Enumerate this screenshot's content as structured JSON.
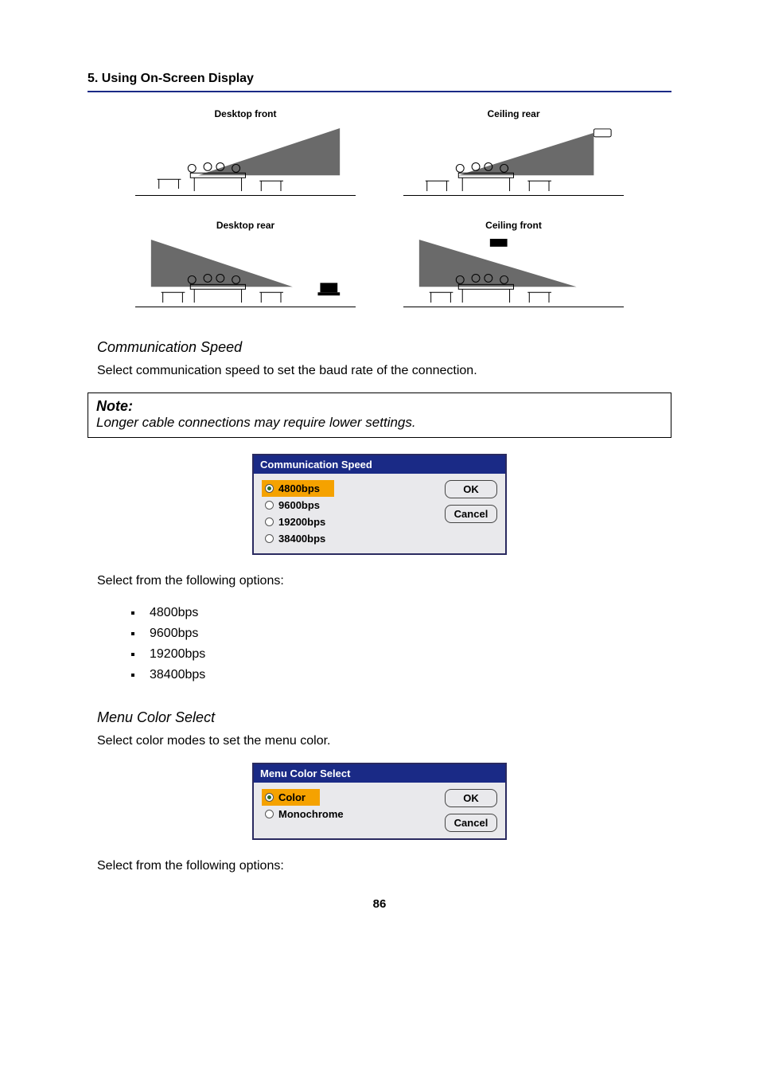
{
  "header": {
    "title": "5. Using On-Screen Display"
  },
  "layouts": {
    "tl": "Desktop front",
    "tr": "Ceiling rear",
    "bl": "Desktop rear",
    "br": "Ceiling front"
  },
  "comm": {
    "heading": "Communication Speed",
    "intro": "Select communication speed to set the baud rate of the connection.",
    "note_title": "Note:",
    "note_body": "Longer cable connections may require lower settings.",
    "dialog_title": "Communication Speed",
    "options": {
      "o1": "4800bps",
      "o2": "9600bps",
      "o3": "19200bps",
      "o4": "38400bps"
    },
    "btn_ok": "OK",
    "btn_cancel": "Cancel",
    "after": "Select from the following options:",
    "bullets": {
      "b1": "4800bps",
      "b2": "9600bps",
      "b3": "19200bps",
      "b4": "38400bps"
    }
  },
  "menucolor": {
    "heading": "Menu Color Select",
    "intro": "Select color modes to set the menu color.",
    "dialog_title": "Menu Color Select",
    "options": {
      "o1": "Color",
      "o2": "Monochrome"
    },
    "btn_ok": "OK",
    "btn_cancel": "Cancel",
    "after": "Select from the following options:"
  },
  "page": "86"
}
